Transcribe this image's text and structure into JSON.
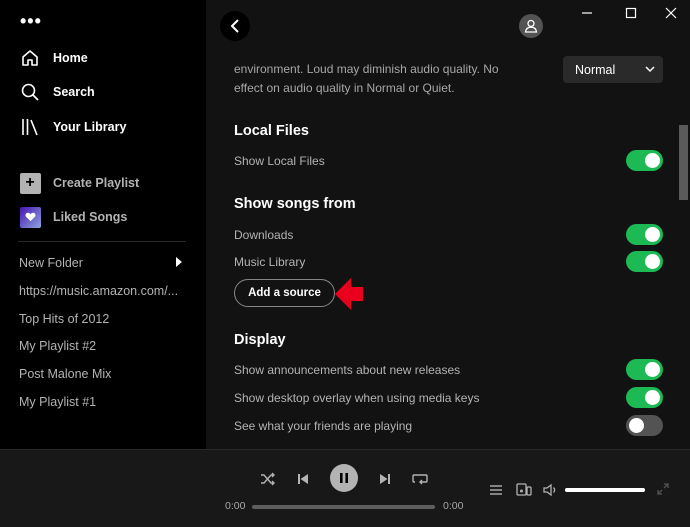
{
  "sidebar": {
    "nav": [
      {
        "label": "Home",
        "icon": "home-icon"
      },
      {
        "label": "Search",
        "icon": "search-icon"
      },
      {
        "label": "Your Library",
        "icon": "library-icon"
      }
    ],
    "create_playlist": "Create Playlist",
    "liked_songs": "Liked Songs",
    "playlists": [
      "New Folder",
      "https://music.amazon.com/...",
      "Top Hits of 2012",
      "My Playlist #2",
      "Post Malone Mix",
      "My Playlist #1"
    ]
  },
  "settings": {
    "volume_desc_line1": "environment. Loud may diminish audio quality. No",
    "volume_desc_line2": "effect on audio quality in Normal or Quiet.",
    "volume_level_value": "Normal",
    "local_files": {
      "title": "Local Files",
      "show_local_files": {
        "label": "Show Local Files",
        "on": true
      }
    },
    "show_songs_from": {
      "title": "Show songs from",
      "sources": [
        {
          "label": "Downloads",
          "on": true
        },
        {
          "label": "Music Library",
          "on": true
        }
      ],
      "add_source_label": "Add a source"
    },
    "display": {
      "title": "Display",
      "options": [
        {
          "label": "Show announcements about new releases",
          "on": true
        },
        {
          "label": "Show desktop overlay when using media keys",
          "on": true
        },
        {
          "label": "See what your friends are playing",
          "on": false
        }
      ]
    }
  },
  "player": {
    "elapsed": "0:00",
    "duration": "0:00",
    "progress": 0,
    "volume": 1.0
  },
  "colors": {
    "accent_green": "#1db954",
    "annotation_red": "#e8001c"
  }
}
